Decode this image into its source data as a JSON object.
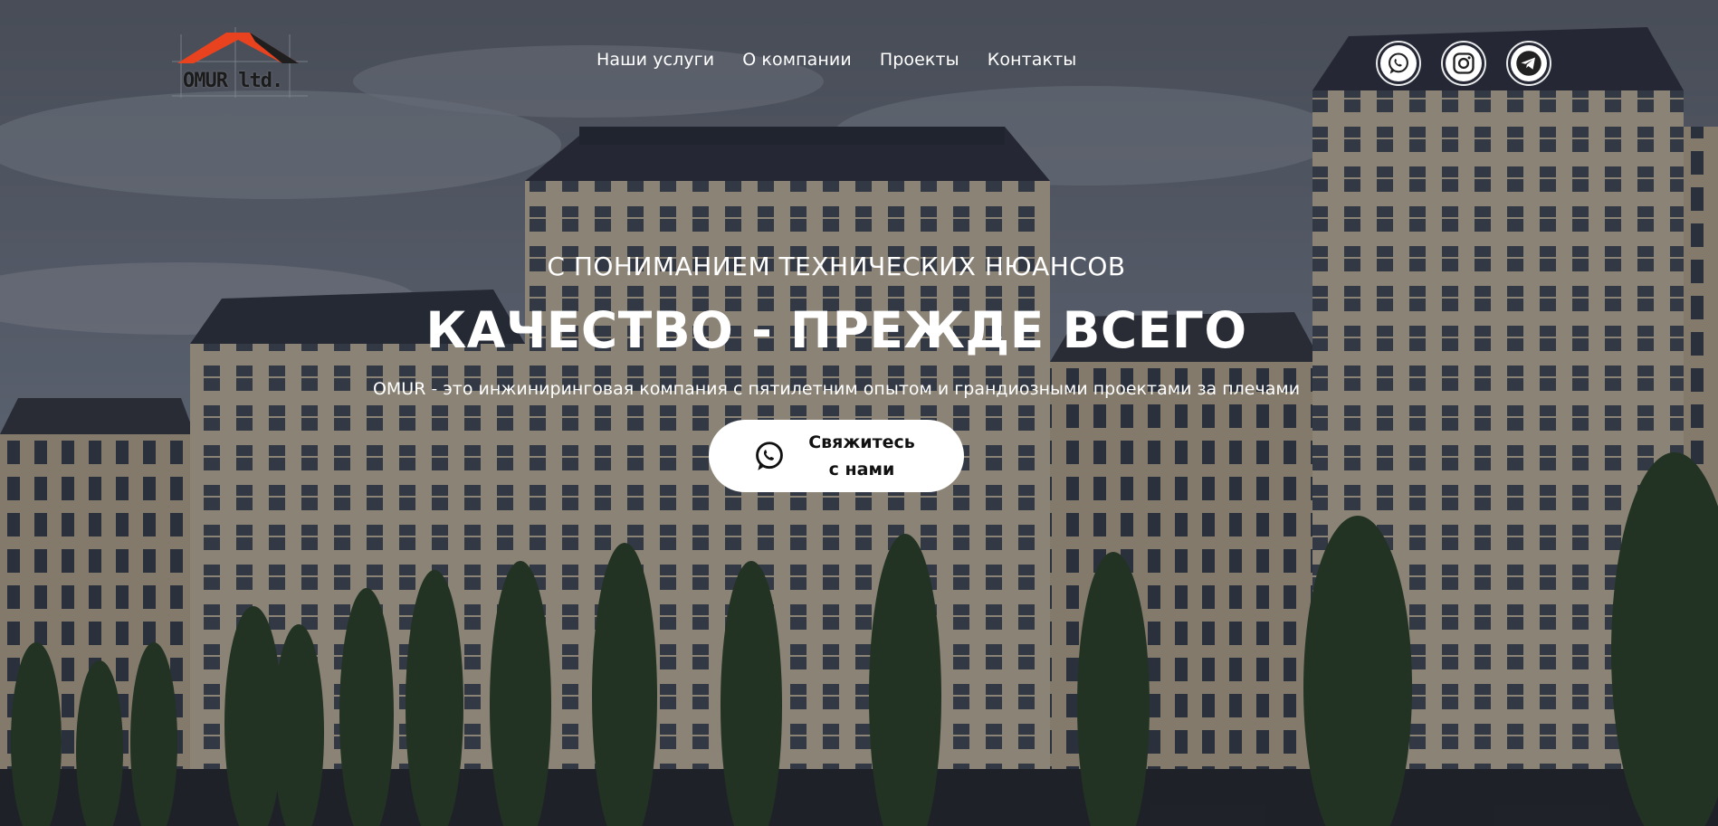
{
  "brand": {
    "logo_text": "OMUR ltd."
  },
  "nav": {
    "items": [
      {
        "label": "Наши услуги"
      },
      {
        "label": "О компании"
      },
      {
        "label": "Проекты"
      },
      {
        "label": "Контакты"
      }
    ]
  },
  "social": {
    "icons": [
      "whatsapp-icon",
      "instagram-icon",
      "telegram-icon"
    ]
  },
  "hero": {
    "subtitle": "С ПОНИМАНИЕМ ТЕХНИЧЕСКИХ НЮАНСОВ",
    "headline": "КАЧЕСТВО - ПРЕЖДЕ ВСЕГО",
    "description": "OMUR - это инжиниринговая компания с пятилетним опытом и грандиозными проектами за плечами",
    "cta_label": "Свяжитесь\nс нами"
  },
  "colors": {
    "overlay": "#0c0e14",
    "logo_roof": "#e8431e",
    "button_bg": "#ffffff",
    "text": "#ffffff"
  }
}
